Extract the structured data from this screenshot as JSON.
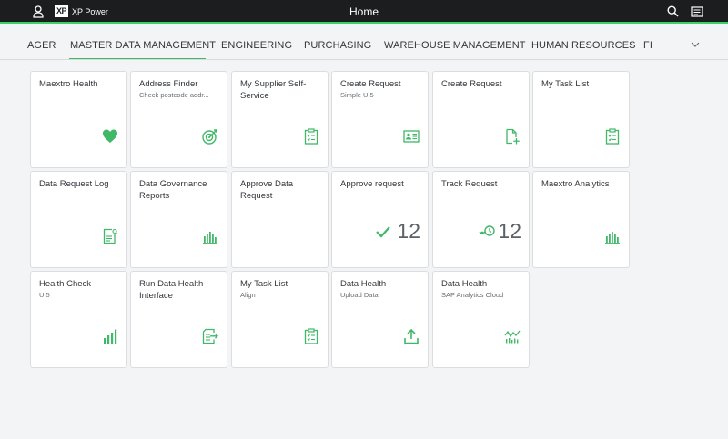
{
  "shell": {
    "logo_mark": "XP",
    "logo_text": "XP Power",
    "title": "Home"
  },
  "tabs": [
    "AGER",
    "MASTER DATA MANAGEMENT",
    "ENGINEERING",
    "PURCHASING",
    "WAREHOUSE MANAGEMENT",
    "HUMAN RESOURCES",
    "FI"
  ],
  "active_tab": "MASTER DATA MANAGEMENT",
  "accent_color": "#3fb868",
  "tiles": [
    {
      "title": "Maextro Health",
      "subtitle": "",
      "icon": "heart-icon"
    },
    {
      "title": "Address Finder",
      "subtitle": "Check postcode addr...",
      "icon": "target-icon"
    },
    {
      "title": "My Supplier Self-Service",
      "subtitle": "",
      "icon": "clipboard-checklist-icon"
    },
    {
      "title": "Create Request",
      "subtitle": "Simple UI5",
      "icon": "contact-card-icon"
    },
    {
      "title": "Create Request",
      "subtitle": "",
      "icon": "add-document-icon"
    },
    {
      "title": "My Task List",
      "subtitle": "",
      "icon": "clipboard-checklist-icon"
    },
    {
      "title": "Data Request Log",
      "subtitle": "",
      "icon": "document-search-icon"
    },
    {
      "title": "Data Governance Reports",
      "subtitle": "",
      "icon": "bar-chart-icon"
    },
    {
      "title": "Approve Data Request",
      "subtitle": "",
      "icon": ""
    },
    {
      "title": "Approve request",
      "subtitle": "",
      "icon": "checkmark-icon",
      "kpi": "12"
    },
    {
      "title": "Track Request",
      "subtitle": "",
      "icon": "history-icon",
      "kpi": "12"
    },
    {
      "title": "Maextro Analytics",
      "subtitle": "",
      "icon": "bar-chart-icon"
    },
    {
      "title": "Health Check",
      "subtitle": "UI5",
      "icon": "vertical-bar-chart-icon"
    },
    {
      "title": "Run Data Health Interface",
      "subtitle": "",
      "icon": "document-export-icon"
    },
    {
      "title": "My Task List",
      "subtitle": "Align",
      "icon": "clipboard-checklist-icon"
    },
    {
      "title": "Data Health",
      "subtitle": "Upload Data",
      "icon": "upload-icon"
    },
    {
      "title": "Data Health",
      "subtitle": "SAP Analytics Cloud",
      "icon": "line-chart-icon"
    }
  ]
}
